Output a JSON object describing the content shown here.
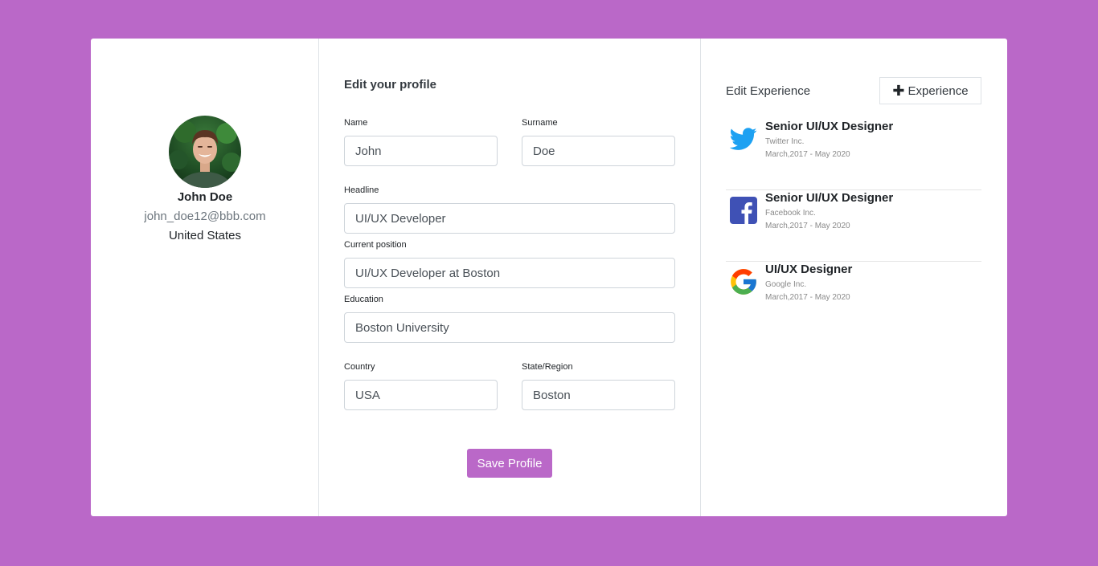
{
  "theme": {
    "background": "#ba68c8",
    "accent": "#ba68c8",
    "card": "#ffffff"
  },
  "profile": {
    "avatar_icon": "user-photo",
    "name": "John Doe",
    "email": "john_doe12@bbb.com",
    "country": "United States"
  },
  "form": {
    "title": "Edit your profile",
    "fields": {
      "name": {
        "label": "Name",
        "value": "John"
      },
      "surname": {
        "label": "Surname",
        "value": "Doe"
      },
      "headline": {
        "label": "Headline",
        "value": "UI/UX Developer"
      },
      "current_position": {
        "label": "Current position",
        "value": "UI/UX Developer at Boston"
      },
      "education": {
        "label": "Education",
        "value": "Boston University"
      },
      "country": {
        "label": "Country",
        "value": "USA"
      },
      "state": {
        "label": "State/Region",
        "value": "Boston"
      }
    },
    "save_label": "Save Profile"
  },
  "experience": {
    "title": "Edit Experience",
    "add_button": {
      "icon": "plus-icon",
      "label": "Experience"
    },
    "items": [
      {
        "logo": "twitter-icon",
        "logo_color": "#1da1f2",
        "role": "Senior UI/UX Designer",
        "company": "Twitter Inc.",
        "dates": "March,2017 - May 2020"
      },
      {
        "logo": "facebook-icon",
        "logo_color": "#3b57b0",
        "role": "Senior UI/UX Designer",
        "company": "Facebook Inc.",
        "dates": "March,2017 - May 2020"
      },
      {
        "logo": "google-icon",
        "logo_color": "#4285f4",
        "role": "UI/UX Designer",
        "company": "Google Inc.",
        "dates": "March,2017 - May 2020"
      }
    ]
  }
}
